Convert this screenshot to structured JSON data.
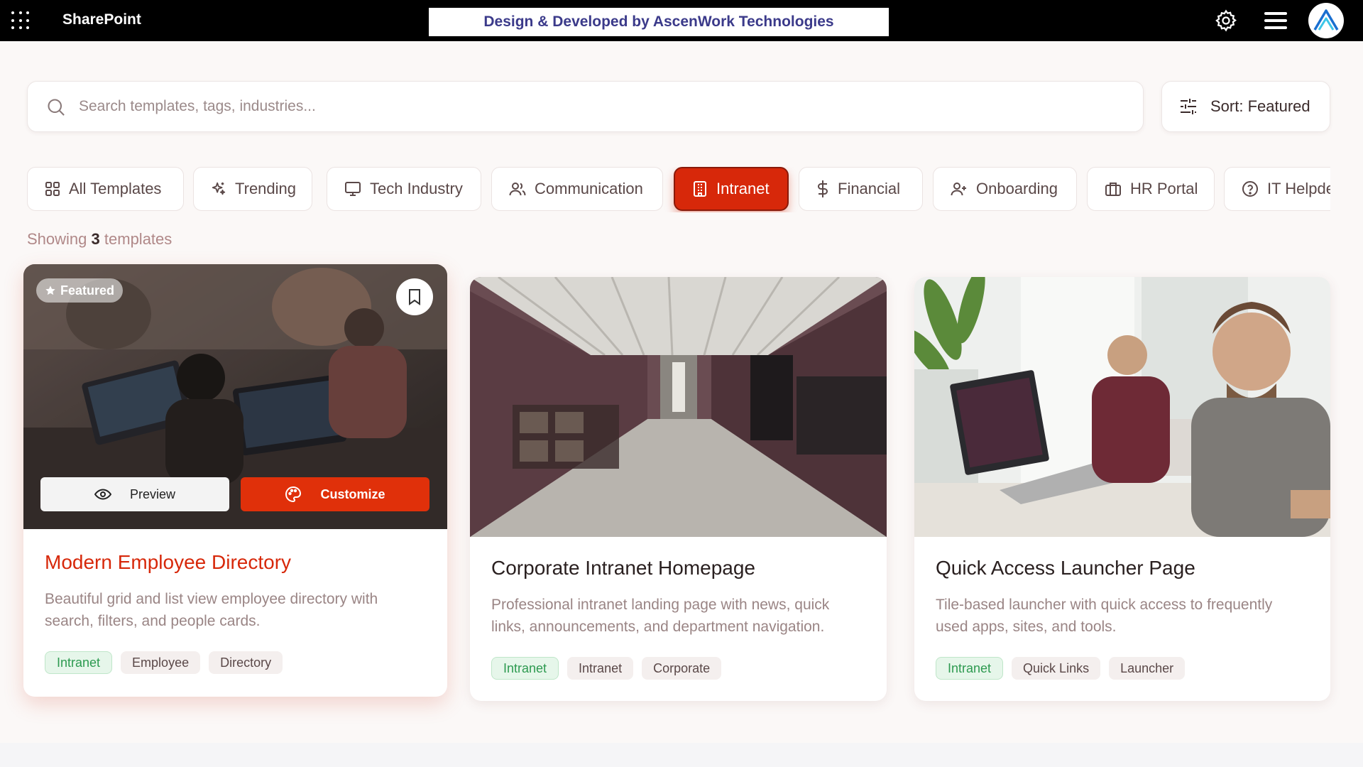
{
  "topbar": {
    "brand": "SharePoint",
    "credit": "Design & Developed by AscenWork Technologies",
    "icons": [
      "app-launcher-icon",
      "gear-icon",
      "hamburger-menu-icon",
      "ascenwork-logo-icon"
    ]
  },
  "search": {
    "placeholder": "Search templates, tags, industries...",
    "value": ""
  },
  "sort": {
    "label": "Sort: Featured"
  },
  "filters": [
    {
      "label": "All Templates",
      "icon": "grid-icon",
      "active": false
    },
    {
      "label": "Trending",
      "icon": "sparkle-icon",
      "active": false
    },
    {
      "label": "Tech Industry",
      "icon": "monitor-icon",
      "active": false
    },
    {
      "label": "Communication",
      "icon": "users-icon",
      "active": false
    },
    {
      "label": "Intranet",
      "icon": "building-icon",
      "active": true
    },
    {
      "label": "Financial",
      "icon": "dollar-icon",
      "active": false
    },
    {
      "label": "Onboarding",
      "icon": "user-plus-icon",
      "active": false
    },
    {
      "label": "HR Portal",
      "icon": "briefcase-icon",
      "active": false
    },
    {
      "label": "IT Helpde",
      "icon": "help-circle-icon",
      "active": false
    }
  ],
  "results": {
    "prefix": "Showing",
    "count": "3",
    "suffix": "templates"
  },
  "cards": [
    {
      "title": "Modern Employee Directory",
      "description": "Beautiful grid and list view employee directory with search, filters, and people cards.",
      "badge": "Featured",
      "preview_label": "Preview",
      "customize_label": "Customize",
      "tags": [
        "Intranet",
        "Employee",
        "Directory"
      ]
    },
    {
      "title": "Corporate Intranet Homepage",
      "description": "Professional intranet landing page with news, quick links, announcements, and department navigation.",
      "tags": [
        "Intranet",
        "Intranet",
        "Corporate"
      ]
    },
    {
      "title": "Quick Access Launcher Page",
      "description": "Tile-based launcher with quick access to frequently used apps, sites, and tools.",
      "tags": [
        "Intranet",
        "Quick Links",
        "Launcher"
      ]
    }
  ],
  "colors": {
    "accent": "#d7280a",
    "topbar": "#000000",
    "credit_text": "#3b3a8a",
    "tag_green": "#2d9a50"
  }
}
